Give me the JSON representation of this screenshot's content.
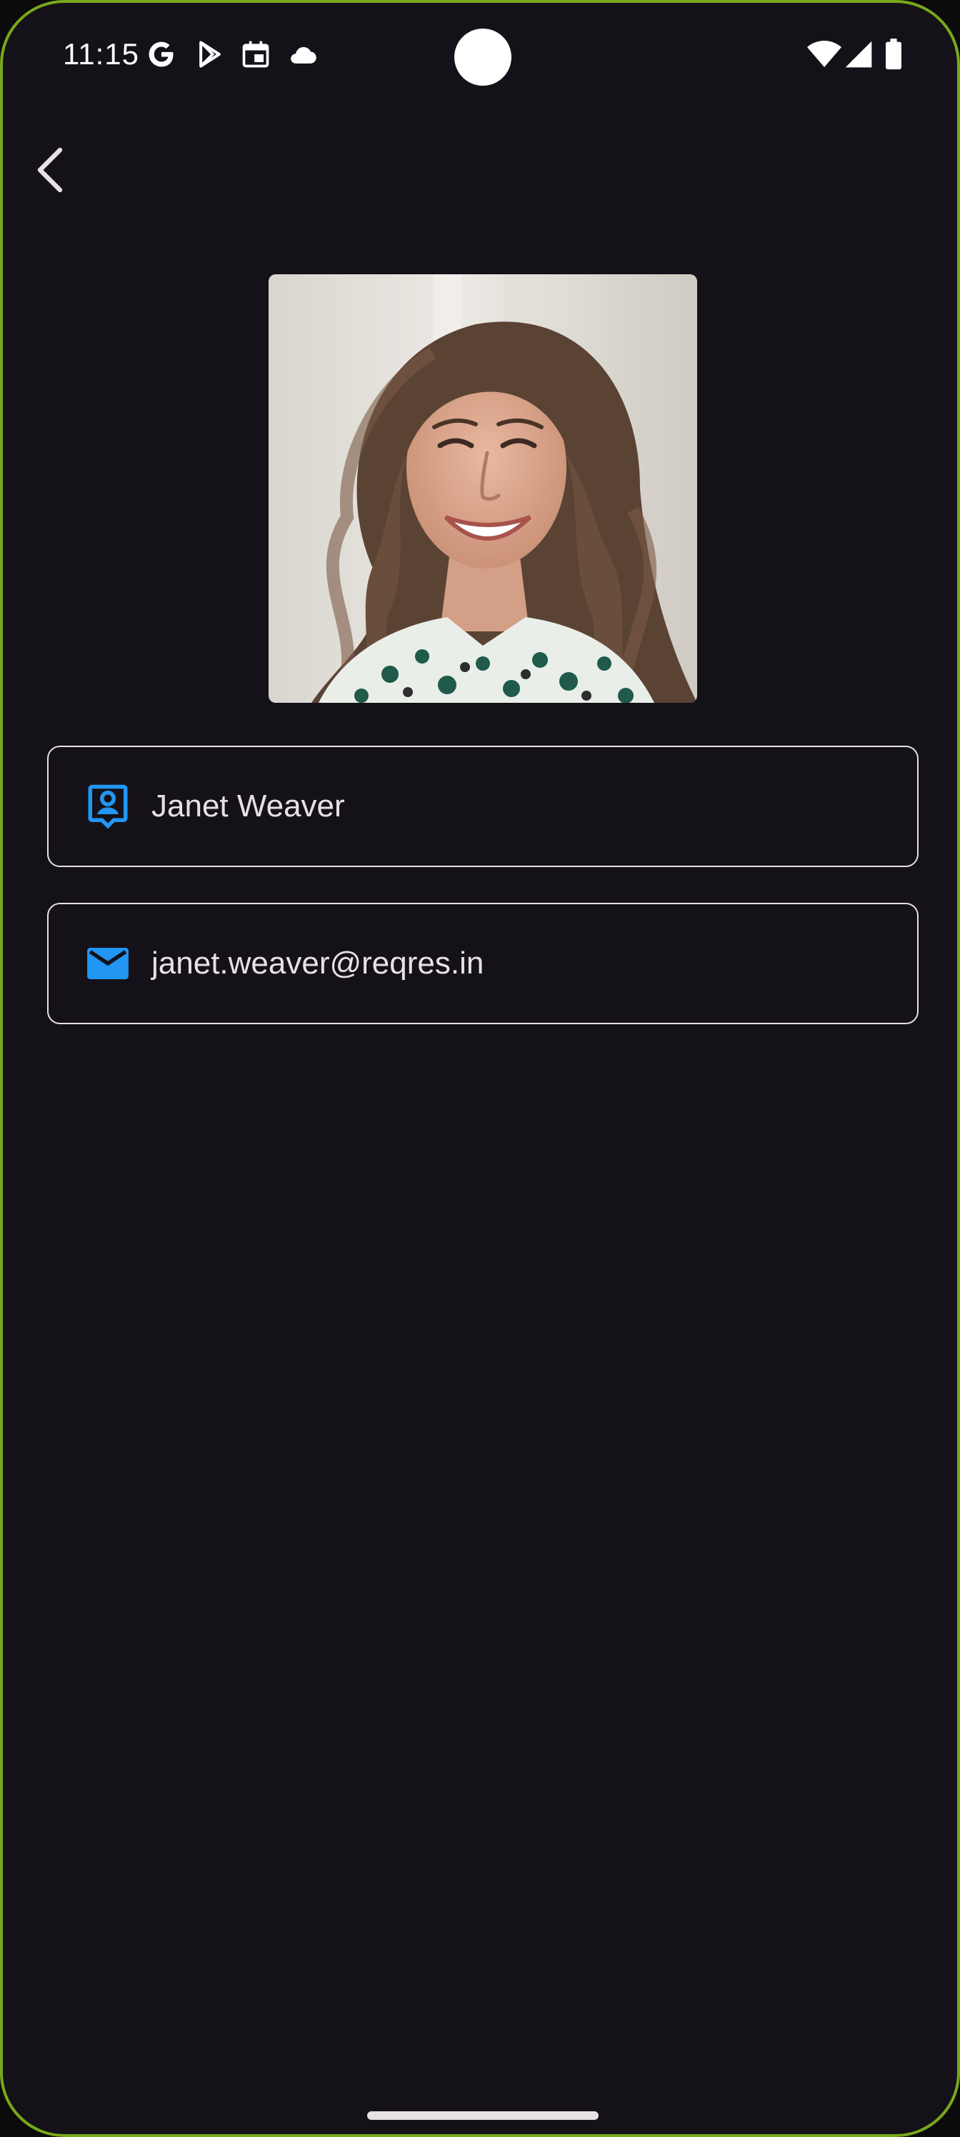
{
  "status_bar": {
    "time": "11:15",
    "left_icons": [
      "google-icon",
      "play-store-icon",
      "calendar-icon",
      "cloud-icon"
    ],
    "right_icons": [
      "wifi-icon",
      "signal-icon",
      "battery-icon"
    ]
  },
  "header": {
    "back_icon": "chevron-left-icon"
  },
  "profile": {
    "avatar_alt": "profile photo",
    "name": "Janet Weaver",
    "email": "janet.weaver@reqres.in",
    "name_icon": "contact-badge-icon",
    "email_icon": "mail-icon"
  },
  "colors": {
    "background": "#141218",
    "accent": "#2196f3",
    "border": "#e6e1e5",
    "text": "#e6e1e5",
    "frame": "#7aa81a"
  }
}
